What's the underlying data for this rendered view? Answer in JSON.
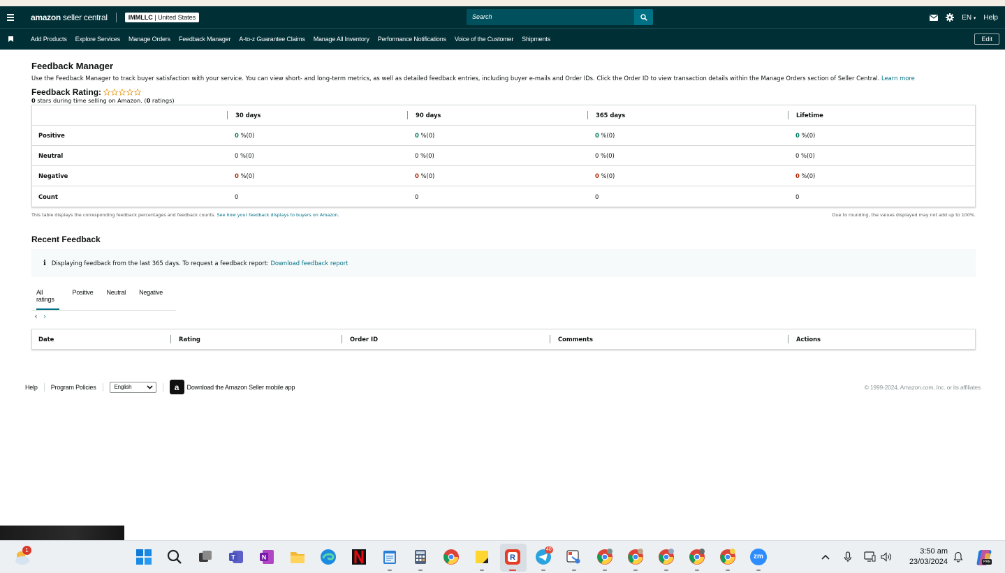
{
  "header": {
    "logo_brand": "amazon",
    "logo_product": "seller central",
    "account_name": "IMMLLC",
    "account_sep": " | ",
    "account_region": "United States",
    "search_placeholder": "Search",
    "language": "EN",
    "help": "Help"
  },
  "nav": {
    "items": [
      "Add Products",
      "Explore Services",
      "Manage Orders",
      "Feedback Manager",
      "A-to-z Guarantee Claims",
      "Manage All Inventory",
      "Performance Notifications",
      "Voice of the Customer",
      "Shipments"
    ],
    "edit": "Edit"
  },
  "page": {
    "title": "Feedback Manager",
    "description": "Use the Feedback Manager to track buyer satisfaction with your service. You can view short- and long-term metrics, as well as detailed feedback entries, including buyer e-mails and Order IDs. Click the Order ID to view transaction details within the Manage Orders section of Seller Central.",
    "learn_more": "Learn more",
    "rating_title": "Feedback Rating:",
    "stars_count": "0",
    "stars_text_a": " stars during time selling on Amazon. (",
    "ratings_count": "0",
    "stars_text_b": " ratings)"
  },
  "metrics_table": {
    "columns": [
      "30 days",
      "90 days",
      "365 days",
      "Lifetime"
    ],
    "rows": [
      {
        "label": "Positive",
        "values": [
          [
            "0",
            " %(0)"
          ],
          [
            "0",
            " %(0)"
          ],
          [
            "0",
            " %(0)"
          ],
          [
            "0",
            " %(0)"
          ]
        ]
      },
      {
        "label": "Neutral",
        "values": [
          [
            "0",
            " %(0)"
          ],
          [
            "0",
            " %(0)"
          ],
          [
            "0",
            " %(0)"
          ],
          [
            "0",
            " %(0)"
          ]
        ]
      },
      {
        "label": "Negative",
        "values": [
          [
            "0",
            " %(0)"
          ],
          [
            "0",
            " %(0)"
          ],
          [
            "0",
            " %(0)"
          ],
          [
            "0",
            " %(0)"
          ]
        ]
      },
      {
        "label": "Count",
        "values": [
          [
            "0",
            ""
          ],
          [
            "0",
            ""
          ],
          [
            "0",
            ""
          ],
          [
            "0",
            ""
          ]
        ]
      }
    ],
    "note_left": "This table displays the corresponding feedback percentages and feedback counts.",
    "note_left_link": "See how your feedback displays to buyers on Amazon.",
    "note_right": "Due to rounding, the values displayed may not add up to 100%."
  },
  "recent": {
    "title": "Recent Feedback",
    "info_icon": "i",
    "info_text": "Displaying feedback from the last 365 days. To request a feedback report:",
    "info_link": "Download feedback report",
    "tabs": [
      "All ratings",
      "Positive",
      "Neutral",
      "Negative"
    ],
    "prev": "‹",
    "next": "›",
    "columns": [
      "Date",
      "Rating",
      "Order ID",
      "Comments",
      "Actions"
    ]
  },
  "footer": {
    "help": "Help",
    "policies": "Program Policies",
    "language": "English",
    "app_icon_letter": "a",
    "app_text": "Download the Amazon Seller mobile app",
    "copyright": "© 1999-2024, Amazon.com, Inc. or its affiliates"
  },
  "taskbar": {
    "weather_badge": "1",
    "telegram_badge": "40",
    "zoom_label": "zm",
    "time": "3:50 am",
    "date": "23/03/2024",
    "copilot_badge": "PRE"
  },
  "colors": {
    "header_bg": "#002f36",
    "link": "#007185",
    "positive": "#067d62",
    "negative": "#b12704",
    "search_button": "#007185"
  }
}
